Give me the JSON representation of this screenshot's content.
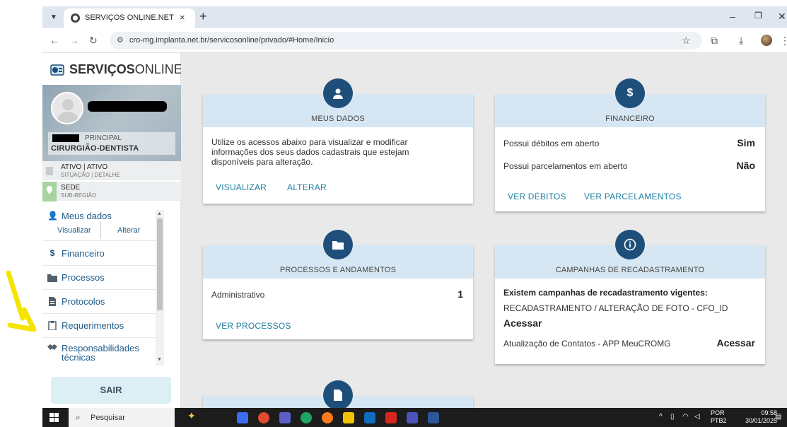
{
  "browser": {
    "tab_title": "SERVIÇOS ONLINE.NET",
    "tab_close": "×",
    "new_tab": "+",
    "url": "cro-mg.implanta.net.br/servicosonline/privado/#Home/Inicio",
    "icons": [
      "tab-menu-icon",
      "favicon-icon",
      "back-icon",
      "forward-icon",
      "reload-icon",
      "site-info-icon",
      "star-icon",
      "extensions-icon",
      "download-icon",
      "profile-icon",
      "menu-icon",
      "minimize-icon",
      "restore-icon",
      "close-icon"
    ]
  },
  "sidebar": {
    "logo_prefix": "SERVIÇOS",
    "logo_suffix": "ONLINE",
    "profile": {
      "role_top": "PRINCIPAL",
      "role_main": "CIRURGIÃO-DENTISTA"
    },
    "status": {
      "main": "ATIVO | ATIVO",
      "sub": "SITUAÇÃO | DETALHE"
    },
    "location": {
      "main": "SEDE",
      "sub": "SUB-REGIÃO"
    },
    "menu": {
      "meus_dados": "Meus dados",
      "visualizar": "Visualizar",
      "alterar": "Alterar",
      "financeiro": "Financeiro",
      "processos": "Processos",
      "protocolos": "Protocolos",
      "requerimentos": "Requerimentos",
      "responsabilidades_1": "Responsabilidades",
      "responsabilidades_2": "técnicas"
    },
    "sair": "SAIR"
  },
  "cards": {
    "meus_dados": {
      "title": "MEUS DADOS",
      "line1": "Utilize os acessos abaixo para visualizar e modificar",
      "line2": "informações dos seus dados cadastrais que estejam",
      "line3": "disponíveis para alteração.",
      "link_view": "VISUALIZAR",
      "link_edit": "ALTERAR"
    },
    "financeiro": {
      "title": "FINANCEIRO",
      "badge": "$",
      "row1_label": "Possui débitos em aberto",
      "row1_value": "Sim",
      "row2_label": "Possui parcelamentos em aberto",
      "row2_value": "Não",
      "link_debitos": "VER DÉBITOS",
      "link_parcelamentos": "VER PARCELAMENTOS"
    },
    "processos": {
      "title": "PROCESSOS E ANDAMENTOS",
      "row_label": "Administrativo",
      "row_value": "1",
      "link": "VER PROCESSOS"
    },
    "campanhas": {
      "title": "CAMPANHAS DE RECADASTRAMENTO",
      "heading": "Existem campanhas de recadastramento vigentes:",
      "campaign1": "RECADASTRAMENTO / ALTERAÇÃO DE FOTO - CFO_ID",
      "access1": "Acessar",
      "campaign2": "Atualização de Contatos - APP MeuCROMG",
      "access2": "Acessar"
    }
  },
  "taskbar": {
    "search": "Pesquisar",
    "lang_1": "POR",
    "lang_2": "PTB2",
    "time": "09:58",
    "date": "30/01/2025"
  },
  "colors": {
    "brand_dark": "#1e4f7a",
    "link": "#1f7f9f",
    "card_header": "#d6e7f3",
    "annotation_arrow": "#f5e400"
  }
}
